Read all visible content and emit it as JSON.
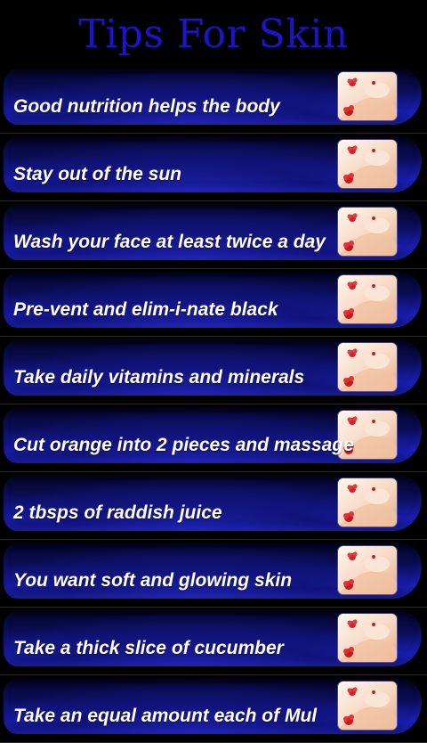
{
  "app": {
    "title": "Tips For Skin"
  },
  "colors": {
    "title": "#1b14c8",
    "background": "#000000",
    "row_blue": "#1a1db0",
    "label": "#ffffff"
  },
  "thumbnail_icon": "spa-face-with-flower-icon",
  "tips": [
    {
      "label": "Good nutrition helps the body"
    },
    {
      "label": "Stay out of the sun"
    },
    {
      "label": "Wash your face at least twice a day"
    },
    {
      "label": "Pre-vent and elim-i-nate black"
    },
    {
      "label": "Take daily vitamins and minerals"
    },
    {
      "label": "Cut orange into 2 pieces and massage"
    },
    {
      "label": "2 tbsps of raddish juice"
    },
    {
      "label": "You want soft and glowing skin"
    },
    {
      "label": "Take a thick slice of cucumber"
    },
    {
      "label": "Take an equal amount each of Mul"
    }
  ]
}
